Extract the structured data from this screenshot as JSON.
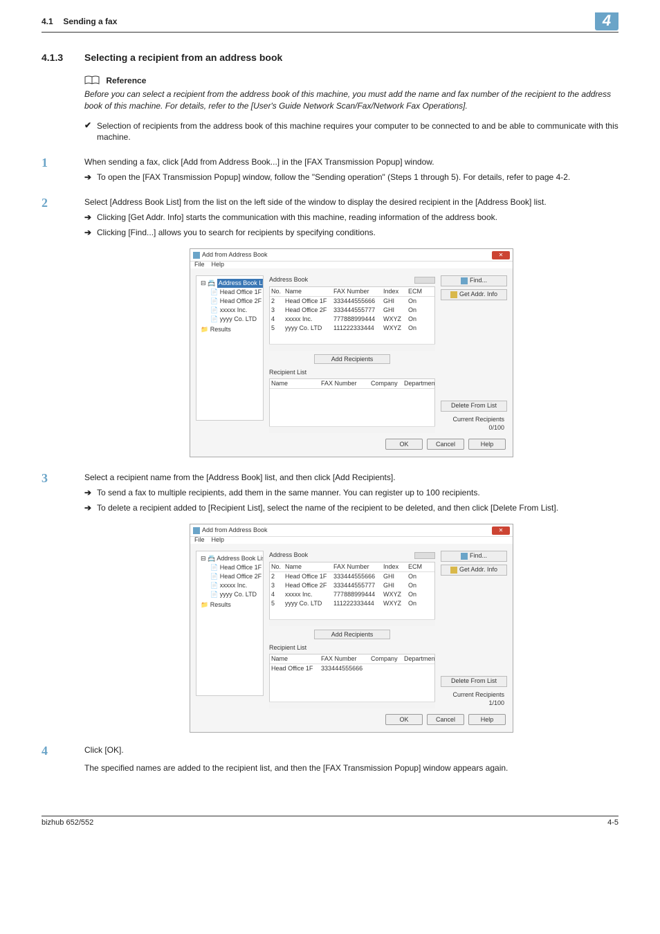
{
  "header": {
    "section_num": "4.1",
    "section_title": "Sending a fax",
    "chapter_badge": "4"
  },
  "subsection": {
    "num": "4.1.3",
    "title": "Selecting a recipient from an address book"
  },
  "reference": {
    "label": "Reference",
    "text": "Before you can select a recipient from the address book of this machine, you must add the name and fax number of the recipient to the address book of this machine. For details, refer to the [User's Guide Network Scan/Fax/Network Fax Operations]."
  },
  "check": {
    "mark": "✔",
    "text": "Selection of recipients from the address book of this machine requires your computer to be connected to and be able to communicate with this machine."
  },
  "steps": {
    "s1": {
      "num": "1",
      "text": "When sending a fax, click [Add from Address Book...] in the [FAX Transmission Popup] window.",
      "sub": "To open the [FAX Transmission Popup] window, follow the \"Sending operation\" (Steps 1 through 5). For details, refer to page 4-2."
    },
    "s2": {
      "num": "2",
      "text": "Select [Address Book List] from the list on the left side of the window to display the desired recipient in the [Address Book] list.",
      "sub1": "Clicking [Get Addr. Info] starts the communication with this machine, reading information of the address book.",
      "sub2": "Clicking [Find...] allows you to search for recipients by specifying conditions."
    },
    "s3": {
      "num": "3",
      "text": "Select a recipient name from the [Address Book] list, and then click [Add Recipients].",
      "sub1": "To send a fax to multiple recipients, add them in the same manner. You can register up to 100 recipients.",
      "sub2": "To delete a recipient added to [Recipient List], select the name of the recipient to be deleted, and then click [Delete From List]."
    },
    "s4": {
      "num": "4",
      "text": "Click [OK].",
      "tail": "The specified names are added to the recipient list, and then the [FAX Transmission Popup] window appears again."
    }
  },
  "dialog": {
    "title": "Add from Address Book",
    "menu_file": "File",
    "menu_help": "Help",
    "tree": {
      "root": "Address Book List",
      "n1": "Head Office 1F",
      "n2": "Head Office 2F",
      "n3": "xxxxx Inc.",
      "n4": "yyyy Co. LTD",
      "results": "Results"
    },
    "address_label": "Address Book",
    "cols": {
      "no": "No.",
      "name": "Name",
      "fax": "FAX Number",
      "index": "Index",
      "ecm": "ECM"
    },
    "rows": [
      {
        "no": "2",
        "name": "Head Office 1F",
        "fax": "333444555666",
        "index": "GHI",
        "ecm": "On"
      },
      {
        "no": "3",
        "name": "Head Office 2F",
        "fax": "333444555777",
        "index": "GHI",
        "ecm": "On"
      },
      {
        "no": "4",
        "name": "xxxxx Inc.",
        "fax": "777888999444",
        "index": "WXYZ",
        "ecm": "On"
      },
      {
        "no": "5",
        "name": "yyyy Co. LTD",
        "fax": "111222333444",
        "index": "WXYZ",
        "ecm": "On"
      }
    ],
    "add_recipients_btn": "Add Recipients",
    "recipient_label": "Recipient List",
    "rcols": {
      "name": "Name",
      "fax": "FAX Number",
      "company": "Company",
      "dept": "Departmen"
    },
    "recipient_row": {
      "name": "Head Office 1F",
      "fax": "333444555666"
    },
    "right": {
      "find": "Find...",
      "get_addr": "Get Addr. Info",
      "delete_from_list": "Delete From List",
      "current_recipients": "Current Recipients",
      "count0": "0/100",
      "count1": "1/100"
    },
    "footer": {
      "ok": "OK",
      "cancel": "Cancel",
      "help": "Help"
    }
  },
  "footer": {
    "left": "bizhub 652/552",
    "right": "4-5"
  }
}
